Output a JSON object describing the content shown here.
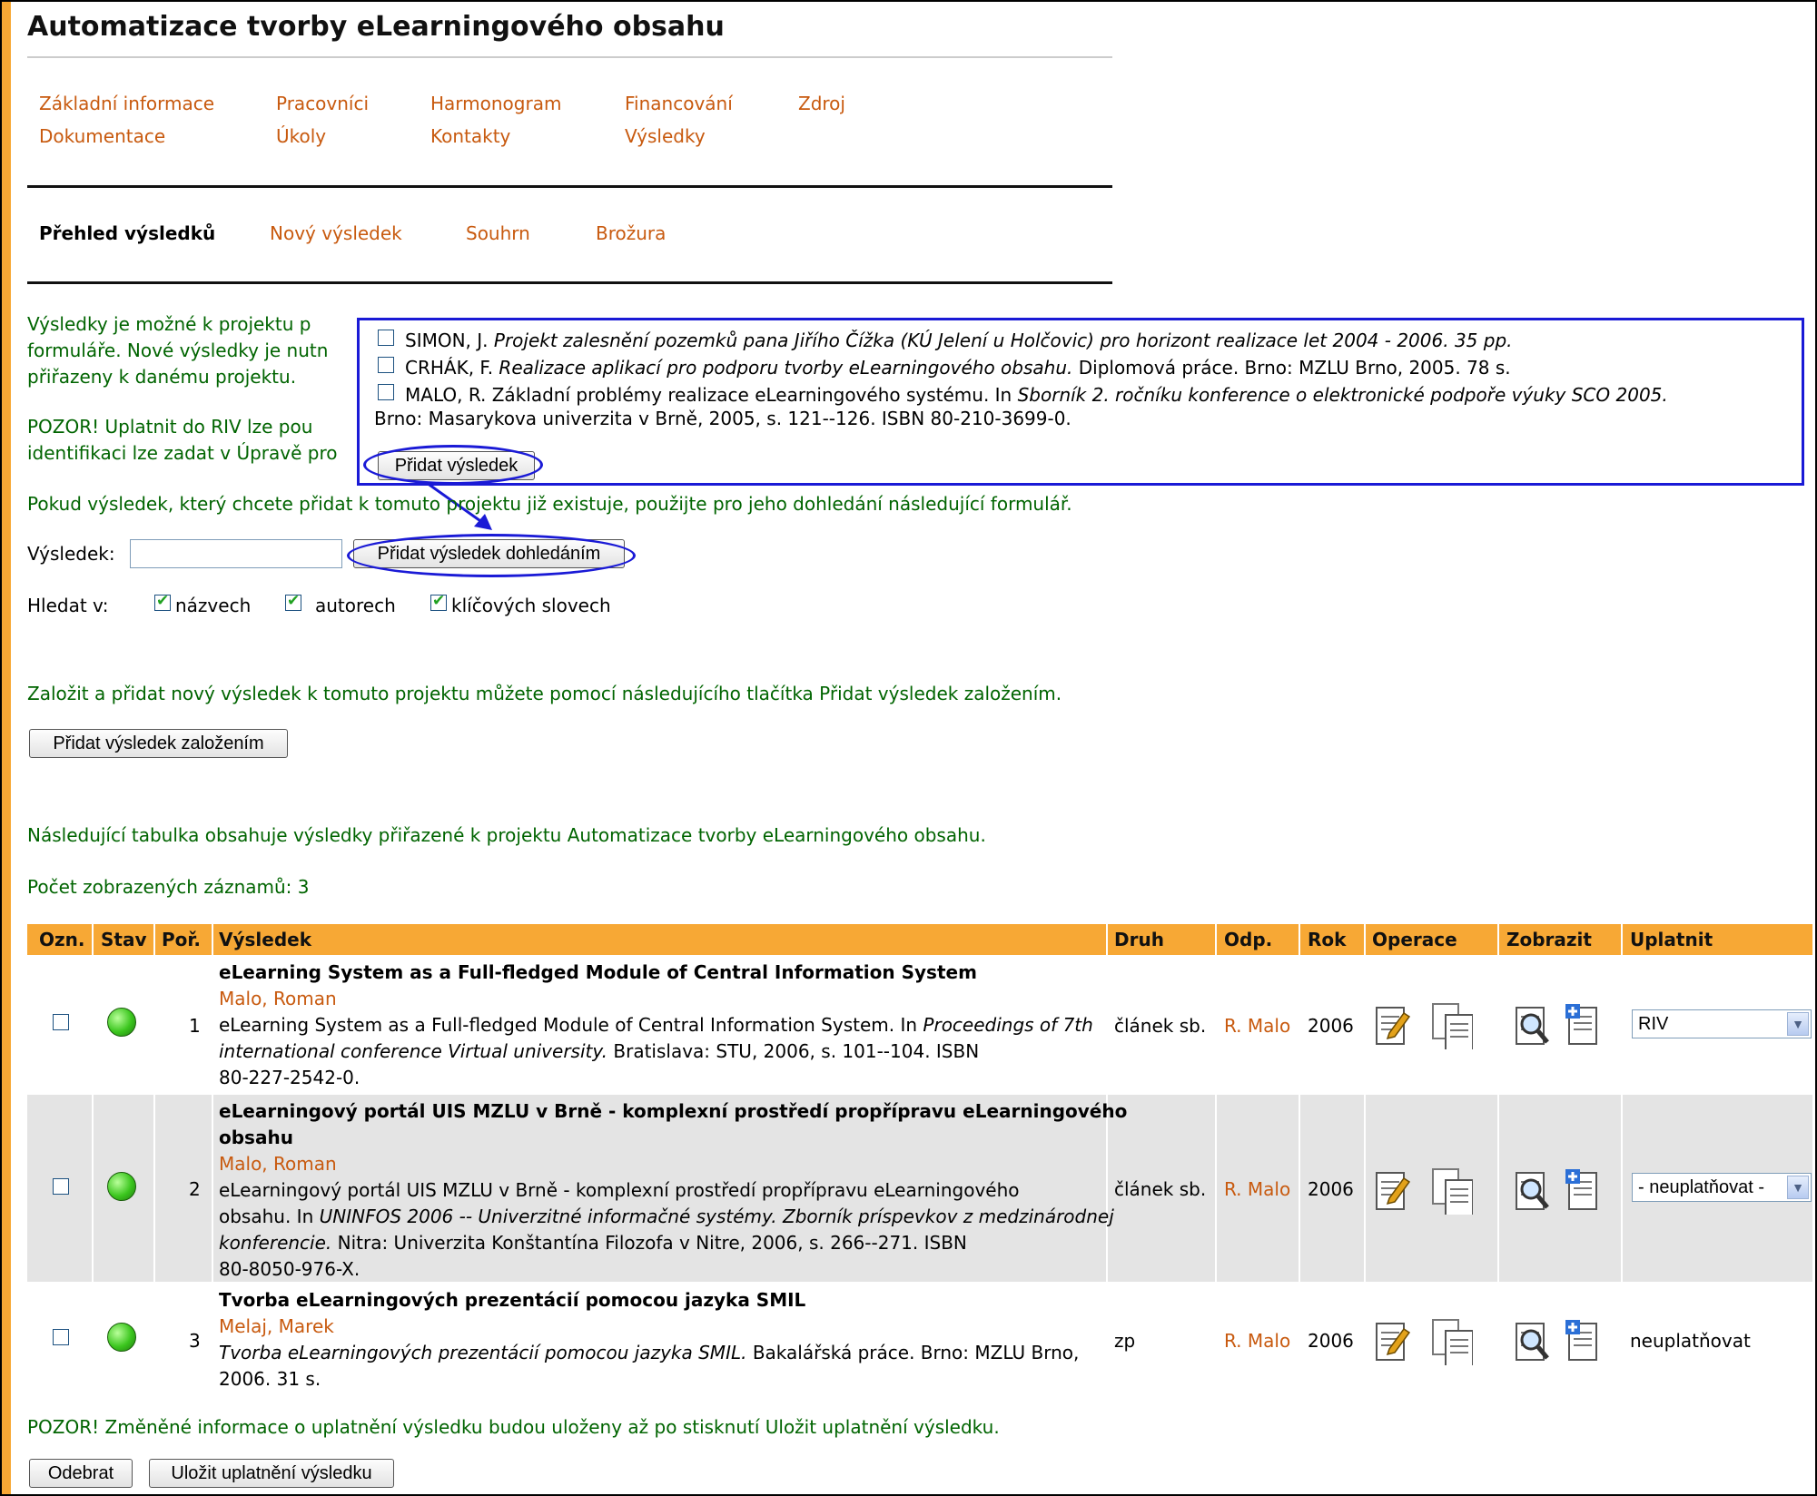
{
  "page": {
    "title": "Automatizace tvorby eLearningového obsahu"
  },
  "nav": {
    "row1": [
      "Základní informace",
      "Pracovníci",
      "Harmonogram",
      "Financování",
      "Zdroj"
    ],
    "row2": [
      "Dokumentace",
      "Úkoly",
      "Kontakty",
      "Výsledky"
    ]
  },
  "subnav": {
    "active": "Přehled výsledků",
    "links": [
      "Nový výsledek",
      "Souhrn",
      "Brožura"
    ]
  },
  "intro": {
    "line1": "Výsledky je možné k projektu p",
    "line2": "formuláře. Nové výsledky je nutn",
    "line3": "přiřazeny k danému projektu.",
    "warn1": "POZOR! Uplatnit do RIV lze pou",
    "warn2": "identifikaci lze zadat v Úpravě pro",
    "search_hint": "Pokud výsledek, který chcete přidat k tomuto projektu již existuje, použijte pro jeho dohledání následující formulář."
  },
  "popup": {
    "items": [
      {
        "author": "SIMON, J.",
        "title": "Projekt zalesnění pozemků pana Jiřího Čížka (KÚ Jelení u Holčovic) pro horizont realizace let 2004 - 2006.",
        "rest": "35 pp."
      },
      {
        "author": "CRHÁK, F.",
        "title": "Realizace aplikací pro podporu tvorby eLearningového obsahu.",
        "rest": "Diplomová práce. Brno: MZLU Brno, 2005. 78 s."
      },
      {
        "author": "MALO, R.",
        "title_plain": "Základní problémy realizace eLearningového systému. In",
        "title": "Sborník 2. ročníku konference o elektronické podpoře výuky SCO 2005.",
        "rest": "Brno: Masarykova univerzita v Brně, 2005, s. 121--126. ISBN 80-210-3699-0."
      }
    ],
    "add_button": "Přidat výsledek"
  },
  "search": {
    "label": "Výsledek:",
    "value": "",
    "find_button": "Přidat výsledek dohledáním",
    "search_in_label": "Hledat v:",
    "options": [
      {
        "label": "názvech",
        "checked": true
      },
      {
        "label": "autorech",
        "checked": true
      },
      {
        "label": "klíčových slovech",
        "checked": true
      }
    ]
  },
  "create": {
    "text": "Založit a přidat nový výsledek k tomuto projektu můžete pomocí následujícího tlačítka Přidat výsledek založením.",
    "button": "Přidat výsledek založením"
  },
  "table_info": {
    "text": "Následující tabulka obsahuje výsledky přiřazené k projektu Automatizace tvorby eLearningového obsahu.",
    "count": "Počet zobrazených záznamů: 3"
  },
  "table": {
    "headers": [
      "Ozn.",
      "Stav",
      "Poř.",
      "Výsledek",
      "Druh",
      "Odp.",
      "Rok",
      "Operace",
      "Zobrazit",
      "Uplatnit"
    ],
    "rows": [
      {
        "num": "1",
        "title": "eLearning System as a Full-fledged Module of Central Information System",
        "author": "Malo, Roman",
        "c1": "eLearning System as a Full-fledged Module of Central Information System. In",
        "c1i": "Proceedings of 7th",
        "c2i": "international conference Virtual university.",
        "c2": "Bratislava: STU, 2006, s. 101--104. ISBN",
        "c3": "80-227-2542-0.",
        "type": "článek sb.",
        "resp": "R. Malo",
        "year": "2006",
        "apply": "RIV"
      },
      {
        "num": "2",
        "title1": "eLearningový portál UIS MZLU v Brně - komplexní prostředí propřípravu eLearningového",
        "title2": "obsahu",
        "author": "Malo, Roman",
        "c1": "eLearningový portál UIS MZLU v Brně - komplexní prostředí propřípravu eLearningového",
        "c2": "obsahu. In",
        "c2i": "UNINFOS 2006 -- Univerzitné informačné systémy. Zborník príspevkov z medzinárodnej",
        "c3i": "konferencie.",
        "c3": "Nitra: Univerzita Konštantína Filozofa v Nitre, 2006, s. 266--271. ISBN",
        "c4": "80-8050-976-X.",
        "type": "článek sb.",
        "resp": "R. Malo",
        "year": "2006",
        "apply": "- neuplatňovat -"
      },
      {
        "num": "3",
        "title": "Tvorba eLearningových prezentácií pomocou jazyka SMIL",
        "author": "Melaj, Marek",
        "c1i": "Tvorba eLearningových prezentácií pomocou jazyka SMIL.",
        "c1": "Bakalářská práce. Brno: MZLU Brno,",
        "c2": "2006. 31 s.",
        "type": "zp",
        "resp": "R. Malo",
        "year": "2006",
        "apply": "neuplatňovat"
      }
    ]
  },
  "footer": {
    "warning": "POZOR! Změněné informace o uplatnění výsledku budou uloženy až po stisknutí Uložit uplatnění výsledku.",
    "remove_button": "Odebrat",
    "save_button": "Uložit uplatnění výsledku"
  },
  "icons": {
    "status": "green-circle-icon",
    "edit": "edit-document-icon",
    "copy": "copy-documents-icon",
    "view": "magnifier-icon",
    "apply": "add-document-icon"
  },
  "colors": {
    "accent": "#f7a835",
    "link": "#c85a0f",
    "info_text": "#006400",
    "annotation": "#1a1ad6"
  }
}
